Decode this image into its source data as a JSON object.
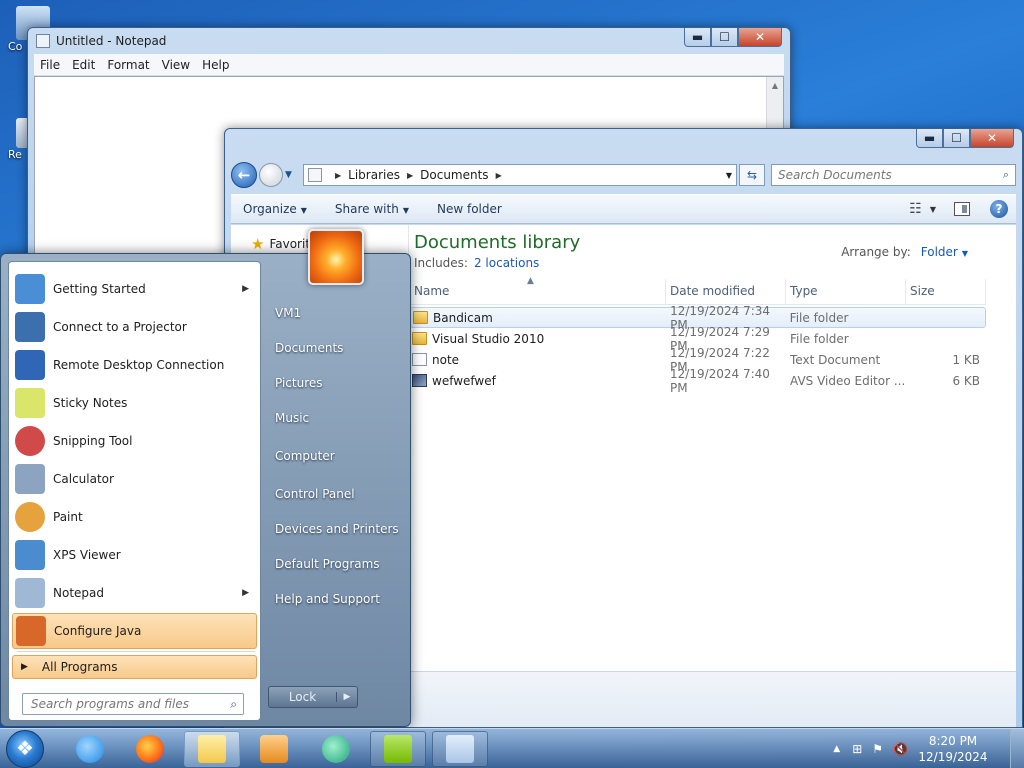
{
  "desktop": {
    "icons": [
      {
        "label": "Co",
        "icon": "computer-icon"
      },
      {
        "label": "Re",
        "icon": "recycle-bin-icon"
      }
    ]
  },
  "notepad": {
    "title": "Untitled - Notepad",
    "menu": [
      "File",
      "Edit",
      "Format",
      "View",
      "Help"
    ],
    "controls": {
      "minimize": "▬",
      "maximize": "☐",
      "close": "✕"
    }
  },
  "explorer": {
    "breadcrumb": [
      "Libraries",
      "Documents"
    ],
    "search_placeholder": "Search Documents",
    "toolbar": {
      "organize": "Organize",
      "share_with": "Share with",
      "new_folder": "New folder"
    },
    "nav": {
      "favorites": "Favorit"
    },
    "library": {
      "title": "Documents library",
      "includes_label": "Includes:",
      "locations_link": "2 locations",
      "arrange_label": "Arrange by:",
      "arrange_value": "Folder"
    },
    "columns": {
      "name": "Name",
      "date": "Date modified",
      "type": "Type",
      "size": "Size"
    },
    "files": [
      {
        "name": "Bandicam",
        "date": "12/19/2024 7:34 PM",
        "type": "File folder",
        "size": "",
        "icon": "folder-icon",
        "selected": true
      },
      {
        "name": "Visual Studio 2010",
        "date": "12/19/2024 7:29 PM",
        "type": "File folder",
        "size": "",
        "icon": "folder-icon",
        "selected": false
      },
      {
        "name": "note",
        "date": "12/19/2024 7:22 PM",
        "type": "Text Document",
        "size": "1 KB",
        "icon": "text-file-icon",
        "selected": false
      },
      {
        "name": "wefwefwef",
        "date": "12/19/2024 7:40 PM",
        "type": "AVS Video Editor ...",
        "size": "6 KB",
        "icon": "video-file-icon",
        "selected": false
      }
    ]
  },
  "start_menu": {
    "programs": [
      {
        "label": "Getting Started",
        "has_submenu": true,
        "color": "#4a8fd6"
      },
      {
        "label": "Connect to a Projector",
        "has_submenu": false,
        "color": "#3b6fae"
      },
      {
        "label": "Remote Desktop Connection",
        "has_submenu": false,
        "color": "#2f66b6"
      },
      {
        "label": "Sticky Notes",
        "has_submenu": false,
        "color": "#d9e66a"
      },
      {
        "label": "Snipping Tool",
        "has_submenu": false,
        "color": "#d14a4a"
      },
      {
        "label": "Calculator",
        "has_submenu": false,
        "color": "#8ca3c2"
      },
      {
        "label": "Paint",
        "has_submenu": false,
        "color": "#e6a23c"
      },
      {
        "label": "XPS Viewer",
        "has_submenu": false,
        "color": "#4b8ccf"
      },
      {
        "label": "Notepad",
        "has_submenu": true,
        "color": "#9fb8d6"
      },
      {
        "label": "Configure Java",
        "has_submenu": false,
        "color": "#d8672a"
      }
    ],
    "all_programs": "All Programs",
    "search_placeholder": "Search programs and files",
    "right_links": [
      "VM1",
      "Documents",
      "Pictures",
      "Music",
      "Computer",
      "Control Panel",
      "Devices and Printers",
      "Default Programs",
      "Help and Support"
    ],
    "lock_label": "Lock"
  },
  "taskbar": {
    "clock_time": "8:20 PM",
    "clock_date": "12/19/2024",
    "apps": [
      {
        "icon": "internet-explorer-icon",
        "color": "#1e88e5"
      },
      {
        "icon": "firefox-icon",
        "color": "#ff6a13"
      },
      {
        "icon": "windows-explorer-icon",
        "color": "#f2c84b"
      },
      {
        "icon": "media-player-icon",
        "color": "#e58a1f"
      },
      {
        "icon": "bandicam-icon",
        "color": "#1fa37a"
      },
      {
        "icon": "nvidia-icon",
        "color": "#76b900"
      },
      {
        "icon": "notepad-icon",
        "color": "#a9c6e8"
      }
    ]
  }
}
